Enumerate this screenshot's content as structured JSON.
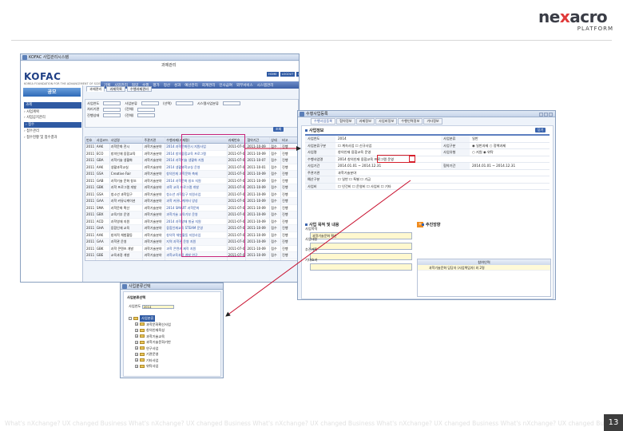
{
  "logo": {
    "main_a": "ne",
    "main_x": "x",
    "main_b": "acro",
    "sub": "PLATFORM"
  },
  "footer": {
    "repeat": "What's nXchange? UX changed Business  What's nXchange? UX changed Business  What's nXchange? UX changed Business  What's nXchange? UX changed Business  What's nXchange? UX changed Business  What's nXchange? UX changed"
  },
  "page_number": "13",
  "w1": {
    "titlebar": "KOFAC 사업관리시스템",
    "title": "과제관리",
    "brand": "KOFAC",
    "brand_sub": "KOREA FOUNDATION FOR THE ADVANCEMENT OF SCIENCE & CREATIVITY",
    "menu": [
      "기획",
      "사업관리",
      "협약",
      "수행",
      "평가",
      "정산",
      "성과",
      "예산관리",
      "회계관리",
      "인사급여",
      "외부서비스",
      "시스템관리"
    ],
    "topbtns": [
      "HOME",
      "LOGOUT",
      "HELP"
    ],
    "tabs": [
      "과제관리",
      "과제목록",
      "수행과제관리"
    ],
    "side_title": "공모",
    "side": [
      {
        "label": "과제",
        "grp": true
      },
      {
        "label": "› 사업계획",
        "grp": false
      },
      {
        "label": "› 사업공지관리",
        "grp": false
      },
      {
        "label": "› 접수",
        "grp": true
      },
      {
        "label": "› 접수관리",
        "grp": false
      },
      {
        "label": "› 접수현황 및 접수결과",
        "grp": false
      }
    ],
    "filters": [
      [
        "사업연도",
        "사업분류",
        "(선택)",
        "시스템사업분류"
      ],
      [
        "처리기관",
        "(전체)",
        "",
        ""
      ],
      [
        "진행상태",
        "(전체)",
        "",
        ""
      ]
    ],
    "search_btn": "조회",
    "grid_cols": [
      "번호",
      "사업코드",
      "사업명",
      "주관기관",
      "수행과제(과제명)",
      "과제번호",
      "협약기간",
      "상태",
      "비고"
    ],
    "rows": [
      [
        "2011",
        "AAK",
        "과학문화 전시",
        "과학기술분야",
        "2014 과학문화전시 지원사업",
        "2011-07-08",
        "2011-10-09",
        "접수",
        "진행"
      ],
      [
        "2011",
        "ECO",
        "창의인재 융합교육",
        "과학기술분야",
        "2014 창의융합교육 프로그램",
        "2011-07-08",
        "2011-10-09",
        "접수",
        "진행"
      ],
      [
        "2011",
        "GBA",
        "과학기술 생활화",
        "과학기술분야",
        "2014 과학기술 생활화 지원",
        "2011-07-07",
        "2011-10-07",
        "접수",
        "진행"
      ],
      [
        "2011",
        "AAK",
        "생활과학교실",
        "과학기술분야",
        "2014 생활과학교실 운영",
        "2011-07-01",
        "2011-10-01",
        "접수",
        "진행"
      ],
      [
        "2011",
        "GSA",
        "Creative Fair",
        "과학기술분야",
        "창의인재 과학문화 축제",
        "2011-07-08",
        "2011-10-09",
        "접수",
        "진행"
      ],
      [
        "2011",
        "GAB",
        "과학기술 문화 창조",
        "과학기술분야",
        "2014 과학문화 창조 지원",
        "2011-07-08",
        "2011-10-09",
        "접수",
        "진행"
      ],
      [
        "2011",
        "GBK",
        "과학 프로그램 개발",
        "과학기술분야",
        "과학 교육 프로그램 개발",
        "2011-07-08",
        "2011-10-09",
        "접수",
        "진행"
      ],
      [
        "2011",
        "GSA",
        "청소년 과학탐구",
        "과학기술분야",
        "청소년 과학탐구 지원사업",
        "2011-07-08",
        "2011-10-09",
        "접수",
        "진행"
      ],
      [
        "2011",
        "GAA",
        "과학 커뮤니케이션",
        "과학기술분야",
        "과학 커뮤니케이터 양성",
        "2011-07-08",
        "2011-10-09",
        "접수",
        "진행"
      ],
      [
        "2011",
        "SMA",
        "과학문화 확산",
        "과학기술분야",
        "2014 SMART 과학문화",
        "2011-07-08",
        "2011-10-09",
        "접수",
        "진행"
      ],
      [
        "2011",
        "GBX",
        "교육기부 운영",
        "과학기술분야",
        "과학기술 교육기부 운영",
        "2011-07-08",
        "2011-10-09",
        "접수",
        "진행"
      ],
      [
        "2011",
        "ACD",
        "과학영재 지원",
        "과학기술분야",
        "2014 과학영재 발굴 지원",
        "2011-07-08",
        "2011-10-09",
        "접수",
        "진행"
      ],
      [
        "2011",
        "GHA",
        "융합인재 교육",
        "과학기술분야",
        "융합인재교육 STEAM 운영",
        "2011-07-08",
        "2011-10-09",
        "접수",
        "진행"
      ],
      [
        "2011",
        "AAK",
        "창의적 체험활동",
        "과학기술분야",
        "창의적 체험활동 지원사업",
        "2011-07-08",
        "2011-10-09",
        "접수",
        "진행"
      ],
      [
        "2011",
        "GAA",
        "과학관 운영",
        "과학기술분야",
        "지역 과학관 운영 지원",
        "2011-07-08",
        "2011-10-09",
        "접수",
        "진행"
      ],
      [
        "2011",
        "GBK",
        "과학 콘텐츠 개발",
        "과학기술분야",
        "과학 콘텐츠 제작 지원",
        "2011-07-08",
        "2011-10-09",
        "접수",
        "진행"
      ],
      [
        "2011",
        "GBE",
        "교육과정 개발",
        "과학기술분야",
        "과학교육과정 개발 연구",
        "2011-07-08",
        "2011-10-09",
        "접수",
        "진행"
      ],
      [
        "2011",
        "AAB",
        "창의교육 확산",
        "과학기술분야",
        "창의교육 거점센터 운영",
        "2011-07-08",
        "2011-10-09",
        "접수",
        "진행"
      ],
      [
        "2011",
        "BEA",
        "과학문화 인프라",
        "과학기술분야",
        "과학문화 인프라 구축",
        "2011-07-08",
        "2011-10-09",
        "접수",
        "진행"
      ],
      [
        "2011",
        "LAA",
        "과학 탐구 지원",
        "과학기술분야",
        "과학탐구 활동 지원",
        "2011-07-08",
        "2011-10-09",
        "접수",
        "진행"
      ]
    ]
  },
  "w2": {
    "titlebar": "수행사업등록",
    "tabs": [
      "수행사업등록",
      "협약정보",
      "과제정보",
      "사업비정보",
      "수행인력정보",
      "기타정보"
    ],
    "sec1": "사업정보",
    "close_btn": "닫기",
    "form": [
      {
        "lb": "사업연도",
        "vl": "2014",
        "lb2": "사업분류",
        "vl2": "일반"
      },
      {
        "lb": "사업분류구분",
        "vl": "☐ 계속사업  ☐ 신규사업",
        "lb2": "사업구분",
        "vl2": "◉ 일반과제  ○ 정책과제"
      },
      {
        "lb": "사업명",
        "vl": "창의인재 융합교육 운영",
        "lb2": "사업유형",
        "vl2": "○ 지원  ◉ 위탁"
      },
      {
        "lb": "수행사업명",
        "vl": "2014 창의인재 융합교육 프로그램 운영",
        "lb2": "",
        "vl2": ""
      },
      {
        "lb": "사업기간",
        "vl": "2014.01.01 ~ 2014.12.31",
        "lb2": "협약기간",
        "vl2": "2014.01.01 ~ 2014.12.31"
      },
      {
        "lb": "주관기관",
        "vl": "과학기술분야",
        "lb2": "",
        "vl2": ""
      },
      {
        "lb": "예산구분",
        "vl": "☐ 일반  ☐ 특별  ☐ 기금",
        "lb2": "",
        "vl2": ""
      },
      {
        "lb": "사업비",
        "vl": "☐ 인건비  ☐ 운영비  ☐ 사업비  ☐ 기타",
        "lb2": "",
        "vl2": ""
      }
    ],
    "sec2": "사업 목적 및 내용",
    "sec3": "추진방향",
    "ta_labels": [
      "사업목적",
      "사업내용",
      "추진계획",
      "기대효과"
    ],
    "ta_values": [
      "과학기술문화 확산",
      "",
      "",
      ""
    ],
    "orange": "+",
    "rp_head": "참여인력",
    "rp_rows": [
      "과학기술문화 담당자 (사업책임자) 외 2명"
    ]
  },
  "w3": {
    "titlebar": "사업분류선택",
    "top_label": "사업분류선택",
    "cb_label": "사업연도",
    "cb_value": "2014",
    "tree": [
      {
        "label": "사업분류",
        "cls": "root selx",
        "plus": "-"
      },
      {
        "label": "과학문화확산사업",
        "cls": "child",
        "plus": "+"
      },
      {
        "label": "창의인재육성",
        "cls": "child",
        "plus": "+"
      },
      {
        "label": "과학기술교육",
        "cls": "child",
        "plus": "+"
      },
      {
        "label": "과학기술문화기반",
        "cls": "child",
        "plus": "+"
      },
      {
        "label": "연구사업",
        "cls": "child",
        "plus": "+"
      },
      {
        "label": "기관운영",
        "cls": "child",
        "plus": "+"
      },
      {
        "label": "기타사업",
        "cls": "child",
        "plus": "+"
      },
      {
        "label": "위탁사업",
        "cls": "child",
        "plus": "+"
      }
    ]
  }
}
